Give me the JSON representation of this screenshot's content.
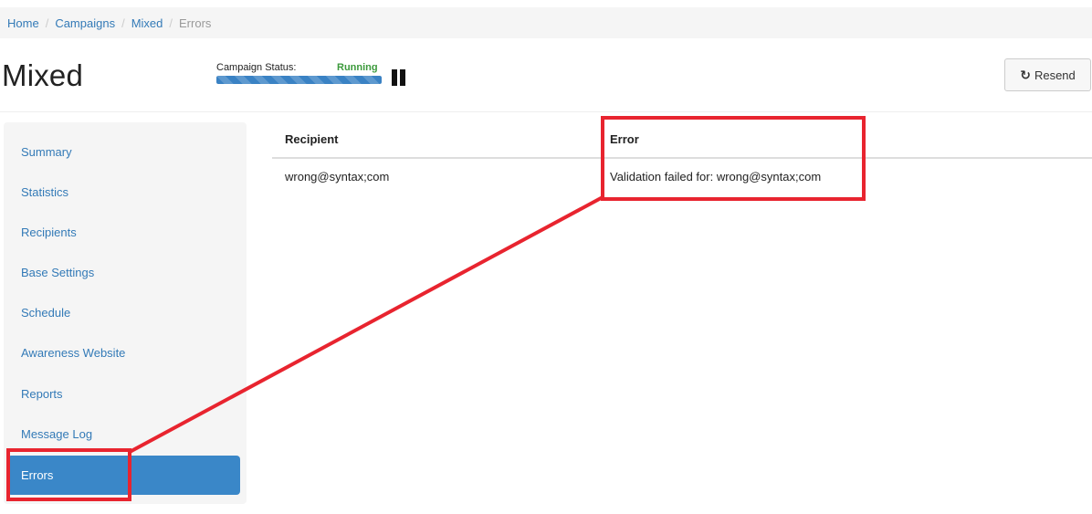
{
  "breadcrumb": {
    "items": [
      {
        "label": "Home"
      },
      {
        "label": "Campaigns"
      },
      {
        "label": "Mixed"
      },
      {
        "label": "Errors"
      }
    ],
    "separator": "/"
  },
  "header": {
    "title": "Mixed",
    "status_label": "Campaign Status:",
    "status_value": "Running",
    "progress_percent": 100,
    "pause_icon": "pause-icon",
    "resend_label": "Resend",
    "resend_icon": "refresh-icon"
  },
  "sidebar": {
    "items": [
      {
        "label": "Summary",
        "active": false
      },
      {
        "label": "Statistics",
        "active": false
      },
      {
        "label": "Recipients",
        "active": false
      },
      {
        "label": "Base Settings",
        "active": false
      },
      {
        "label": "Schedule",
        "active": false
      },
      {
        "label": "Awareness Website",
        "active": false
      },
      {
        "label": "Reports",
        "active": false
      },
      {
        "label": "Message Log",
        "active": false
      },
      {
        "label": "Errors",
        "active": true
      }
    ]
  },
  "table": {
    "columns": [
      "Recipient",
      "Error"
    ],
    "rows": [
      [
        "wrong@syntax;com",
        "Validation failed for: wrong@syntax;com"
      ]
    ]
  },
  "colors": {
    "link": "#337ab7",
    "active_nav": "#3a87c8",
    "status_running": "#3c9a3c",
    "annotation": "#e8242f"
  }
}
